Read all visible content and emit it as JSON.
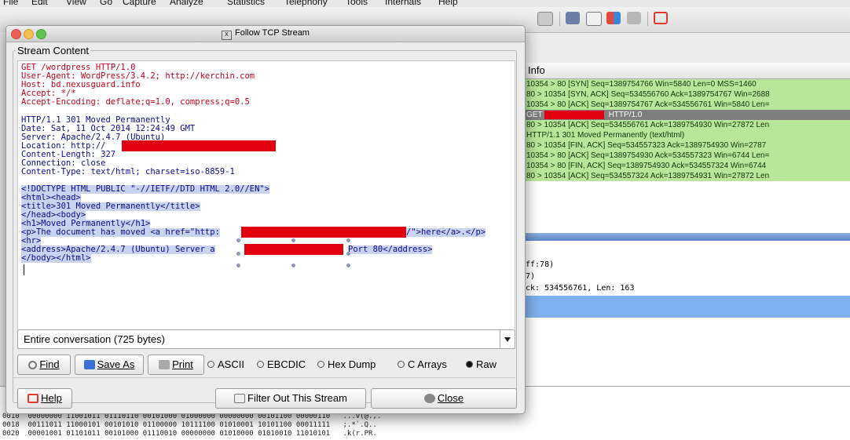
{
  "menu": [
    "File",
    "Edit",
    "View",
    "Go",
    "Capture",
    "Analyze",
    "Statistics",
    "Telephony",
    "Tools",
    "Internals",
    "Help"
  ],
  "packet_list": {
    "header": "Info",
    "rows": [
      {
        "text": "10354 > 80 [SYN] Seq=1389754766 Win=5840 Len=0 MSS=1460",
        "style": "green"
      },
      {
        "text": "80 > 10354 [SYN, ACK] Seq=534556760 Ack=1389754767 Win=2688",
        "style": "green"
      },
      {
        "text": "10354 > 80 [ACK] Seq=1389754767 Ack=534556761 Win=5840 Len=",
        "style": "green"
      },
      {
        "prefix": "GET",
        "text": "HTTP/1.0",
        "style": "sel"
      },
      {
        "text": "80 > 10354 [ACK] Seq=534556761 Ack=1389754930 Win=27872 Len",
        "style": "green"
      },
      {
        "text": "HTTP/1.1 301 Moved Permanently  (text/html)",
        "style": "green"
      },
      {
        "text": "80 > 10354 [FIN, ACK] Seq=534557323 Ack=1389754930 Win=2787",
        "style": "green"
      },
      {
        "text": "10354 > 80 [ACK] Seq=1389754930 Ack=534557323 Win=6744 Len=",
        "style": "green"
      },
      {
        "text": "10354 > 80 [FIN, ACK] Seq=1389754930 Ack=534557324 Win=6744",
        "style": "green"
      },
      {
        "text": "80 > 10354 [ACK] Seq=534557324 Ack=1389754931 Win=27872 Len",
        "style": "green"
      }
    ]
  },
  "details": {
    "rows": [
      "ff:78)",
      "7)",
      "ck: 534556761, Len: 163"
    ]
  },
  "hex": {
    "rows": [
      "0010  00000000 11001011 01110110 00101000 01000000 00000000 00101100 00000110   ...v(@.,.",
      "0018  00111011 11000101 00101010 01100000 10111100 01010001 10101100 00011111   ;.*`.Q..",
      "0020  00001001 01101011 00101000 01110010 00000000 01010000 01010010 11010101   .k(r.PR."
    ]
  },
  "dialog": {
    "title": "Follow TCP Stream",
    "section_label": "Stream Content",
    "request_lines": [
      "GET /wordpress HTTP/1.0",
      "User-Agent: WordPress/3.4.2; http://kerchin.com",
      "Host: bd.nexusguard.info",
      "Accept: */*",
      "Accept-Encoding: deflate;q=1.0, compress;q=0.5"
    ],
    "response_headers": [
      "HTTP/1.1 301 Moved Permanently",
      "Date: Sat, 11 Oct 2014 12:24:49 GMT",
      "Server: Apache/2.4.7 (Ubuntu)",
      "Location: http://",
      "Content-Length: 327",
      "Connection: close",
      "Content-Type: text/html; charset=iso-8859-1"
    ],
    "response_body": [
      "<!DOCTYPE HTML PUBLIC \"-//IETF//DTD HTML 2.0//EN\">",
      "<html><head>",
      "<title>301 Moved Permanently</title>",
      "</head><body>",
      "<h1>Moved Permanently</h1>",
      "<p>The document has moved <a href=\"http:",
      "<hr>",
      "<address>Apache/2.4.7 (Ubuntu) Server a",
      "</body></html>"
    ],
    "body_line6_tail": "/\">here</a>.</p>",
    "body_line8_tail": "Port 80</address>",
    "conversation": "Entire conversation (725 bytes)",
    "buttons": {
      "find": "Find",
      "save_as": "Save As",
      "print": "Print",
      "help": "Help",
      "filter": "Filter Out This Stream",
      "close": "Close"
    },
    "formats": [
      "ASCII",
      "EBCDIC",
      "Hex Dump",
      "C Arrays",
      "Raw"
    ],
    "selected_format": "Raw"
  },
  "colors": {
    "redaction": "#e10010",
    "packet_green": "#b9e79a",
    "selected_row": "#7f7f7f",
    "request_text": "#c0001a",
    "response_text": "#0a0a8c"
  }
}
